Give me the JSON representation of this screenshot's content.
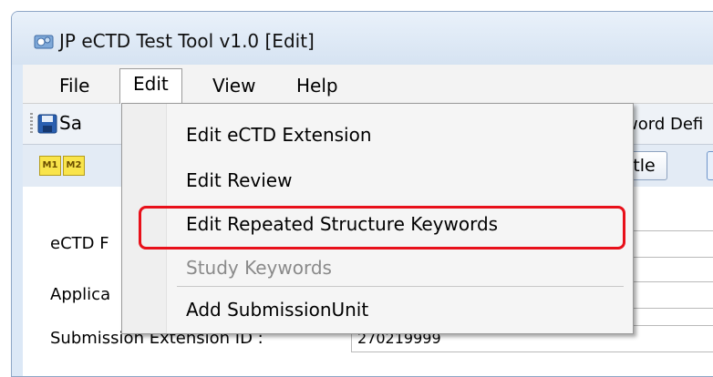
{
  "window": {
    "title": "JP eCTD Test Tool v1.0 [Edit]"
  },
  "menubar": {
    "items": [
      "File",
      "Edit",
      "View",
      "Help"
    ]
  },
  "toolbar": {
    "save_label": "Sa",
    "keyword_label": "word Defi"
  },
  "modulebar": {
    "buttons": [
      "M1",
      "M2"
    ],
    "title_button": "Title"
  },
  "form": {
    "labels": [
      "eCTD F",
      "Applica",
      "Submission Extension ID :"
    ],
    "submission_extension_id": "270219999"
  },
  "edit_menu": {
    "items": [
      {
        "label": "Edit eCTD Extension",
        "enabled": true
      },
      {
        "label": "Edit Review",
        "enabled": true
      },
      {
        "label": "Edit Repeated Structure Keywords",
        "enabled": true,
        "highlighted": true
      },
      {
        "label": "Study Keywords",
        "enabled": false
      },
      {
        "label": "Add SubmissionUnit",
        "enabled": true
      }
    ]
  },
  "colors": {
    "highlight": "#e8101a",
    "window_bg": "#dce8f6",
    "module_button": "#f9e44b"
  }
}
